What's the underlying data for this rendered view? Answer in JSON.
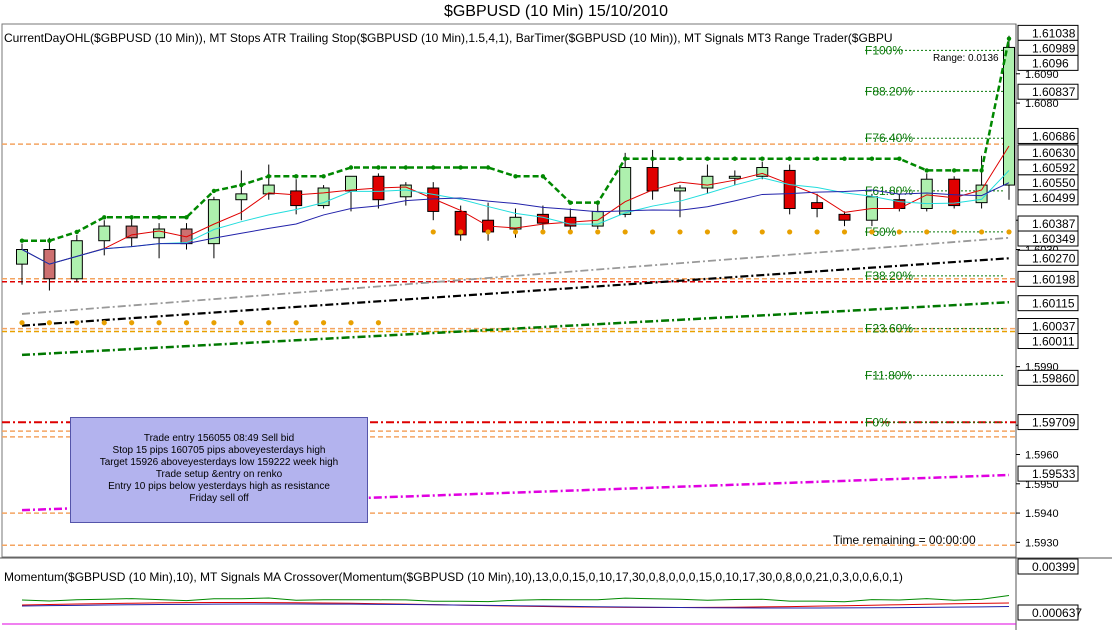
{
  "chart_data": {
    "type": "candlestick",
    "title": "$GBPUSD (10 Min)  15/10/2010",
    "main_panel": {
      "indicator_label": "CurrentDayOHL($GBPUSD (10 Min)), MT Stops ATR Trailing Stop($GBPUSD (10 Min),1.5,4,1), BarTimer($GBPUSD (10 Min)), MT Signals MT3 Range Trader($GBPU",
      "y_axis": {
        "min": 1.5925,
        "max": 1.6107,
        "ticks": [
          "1.5930",
          "1.5940",
          "1.5950",
          "1.5960",
          "1.5970",
          "1.5990",
          "1.6030",
          "1.6040",
          "1.6080",
          "1.6090"
        ]
      },
      "price_boxes": [
        "1.61038",
        "1.60989",
        "1.6096",
        "1.60837",
        "1.60686",
        "1.60630",
        "1.60592",
        "1.60550",
        "1.60499",
        "1.60387",
        "1.60349",
        "1.60270",
        "1.60198",
        "1.60115",
        "1.60037",
        "1.60011",
        "1.59860",
        "1.59709",
        "1.59533"
      ],
      "candles": [
        {
          "o": 1.6025,
          "h": 1.6032,
          "l": 1.6018,
          "c": 1.603,
          "dir": "up"
        },
        {
          "o": 1.603,
          "h": 1.6034,
          "l": 1.6016,
          "c": 1.602,
          "dir": "down"
        },
        {
          "o": 1.602,
          "h": 1.6035,
          "l": 1.6019,
          "c": 1.6033,
          "dir": "up"
        },
        {
          "o": 1.6033,
          "h": 1.604,
          "l": 1.6028,
          "c": 1.6038,
          "dir": "up"
        },
        {
          "o": 1.6038,
          "h": 1.6041,
          "l": 1.6031,
          "c": 1.6034,
          "dir": "down"
        },
        {
          "o": 1.6034,
          "h": 1.6039,
          "l": 1.6027,
          "c": 1.6037,
          "dir": "up"
        },
        {
          "o": 1.6037,
          "h": 1.6039,
          "l": 1.603,
          "c": 1.6032,
          "dir": "down"
        },
        {
          "o": 1.6032,
          "h": 1.6048,
          "l": 1.6027,
          "c": 1.6047,
          "dir": "up"
        },
        {
          "o": 1.6047,
          "h": 1.6057,
          "l": 1.604,
          "c": 1.6049,
          "dir": "up"
        },
        {
          "o": 1.6049,
          "h": 1.6059,
          "l": 1.6047,
          "c": 1.6052,
          "dir": "up"
        },
        {
          "o": 1.605,
          "h": 1.6054,
          "l": 1.6042,
          "c": 1.6045,
          "dir": "down"
        },
        {
          "o": 1.6045,
          "h": 1.6052,
          "l": 1.6044,
          "c": 1.6051,
          "dir": "up"
        },
        {
          "o": 1.605,
          "h": 1.6055,
          "l": 1.6043,
          "c": 1.6055,
          "dir": "up"
        },
        {
          "o": 1.6055,
          "h": 1.6056,
          "l": 1.6044,
          "c": 1.6047,
          "dir": "down"
        },
        {
          "o": 1.6048,
          "h": 1.6053,
          "l": 1.6045,
          "c": 1.6052,
          "dir": "up"
        },
        {
          "o": 1.6051,
          "h": 1.6053,
          "l": 1.604,
          "c": 1.6043,
          "dir": "down"
        },
        {
          "o": 1.6043,
          "h": 1.6045,
          "l": 1.6033,
          "c": 1.6035,
          "dir": "down"
        },
        {
          "o": 1.604,
          "h": 1.6046,
          "l": 1.6033,
          "c": 1.6036,
          "dir": "down"
        },
        {
          "o": 1.6037,
          "h": 1.6044,
          "l": 1.6034,
          "c": 1.6041,
          "dir": "up"
        },
        {
          "o": 1.6042,
          "h": 1.6045,
          "l": 1.6036,
          "c": 1.6039,
          "dir": "down"
        },
        {
          "o": 1.6041,
          "h": 1.6044,
          "l": 1.6036,
          "c": 1.6038,
          "dir": "down"
        },
        {
          "o": 1.6038,
          "h": 1.6046,
          "l": 1.6037,
          "c": 1.6043,
          "dir": "up"
        },
        {
          "o": 1.6042,
          "h": 1.6063,
          "l": 1.6041,
          "c": 1.6058,
          "dir": "up"
        },
        {
          "o": 1.6058,
          "h": 1.6064,
          "l": 1.6047,
          "c": 1.605,
          "dir": "down"
        },
        {
          "o": 1.605,
          "h": 1.6052,
          "l": 1.6041,
          "c": 1.6051,
          "dir": "up"
        },
        {
          "o": 1.6051,
          "h": 1.6059,
          "l": 1.6049,
          "c": 1.6055,
          "dir": "up"
        },
        {
          "o": 1.6055,
          "h": 1.6057,
          "l": 1.6052,
          "c": 1.6055,
          "dir": "up"
        },
        {
          "o": 1.6055,
          "h": 1.606,
          "l": 1.6054,
          "c": 1.6058,
          "dir": "up"
        },
        {
          "o": 1.6057,
          "h": 1.6059,
          "l": 1.6042,
          "c": 1.6044,
          "dir": "down"
        },
        {
          "o": 1.6046,
          "h": 1.6049,
          "l": 1.6041,
          "c": 1.6044,
          "dir": "down"
        },
        {
          "o": 1.6042,
          "h": 1.6043,
          "l": 1.6038,
          "c": 1.604,
          "dir": "down"
        },
        {
          "o": 1.604,
          "h": 1.6049,
          "l": 1.6038,
          "c": 1.6048,
          "dir": "up"
        },
        {
          "o": 1.6047,
          "h": 1.6049,
          "l": 1.6043,
          "c": 1.6044,
          "dir": "down"
        },
        {
          "o": 1.6044,
          "h": 1.6056,
          "l": 1.6043,
          "c": 1.6054,
          "dir": "up"
        },
        {
          "o": 1.6054,
          "h": 1.6055,
          "l": 1.6044,
          "c": 1.6045,
          "dir": "down"
        },
        {
          "o": 1.6046,
          "h": 1.6062,
          "l": 1.6044,
          "c": 1.6052,
          "dir": "up"
        },
        {
          "o": 1.6052,
          "h": 1.6103,
          "l": 1.6047,
          "c": 1.6099,
          "dir": "up"
        }
      ],
      "fib_levels": [
        {
          "label": "F100%",
          "value": 1.6098
        },
        {
          "label": "F88.20%",
          "value": 1.6084
        },
        {
          "label": "F76.40%",
          "value": 1.6068
        },
        {
          "label": "F61.80%",
          "value": 1.605
        },
        {
          "label": "F50%",
          "value": 1.6036
        },
        {
          "label": "F38.20%",
          "value": 1.6021
        },
        {
          "label": "F23.60%",
          "value": 1.6003
        },
        {
          "label": "F11.80%",
          "value": 1.5987
        },
        {
          "label": "F0%",
          "value": 1.5971
        }
      ],
      "range_label": "Range: 0.0136",
      "horizontal_lines": [
        {
          "value": 1.6066,
          "color": "#f4a460",
          "style": "dashed"
        },
        {
          "value": 1.6019,
          "color": "#dd0000",
          "style": "dashed"
        },
        {
          "value": 1.602,
          "color": "#f4a460",
          "style": "dashed"
        },
        {
          "value": 1.6002,
          "color": "#e8a000",
          "style": "dashed"
        },
        {
          "value": 1.6003,
          "color": "#f4a460",
          "style": "dashed"
        },
        {
          "value": 1.5971,
          "color": "#dd0000",
          "style": "dashdot"
        },
        {
          "value": 1.5968,
          "color": "#f4a460",
          "style": "dashed"
        },
        {
          "value": 1.5966,
          "color": "#f4a460",
          "style": "dashed"
        },
        {
          "value": 1.594,
          "color": "#f4a460",
          "style": "dashed"
        },
        {
          "value": 1.5929,
          "color": "#f4a460",
          "style": "dashed"
        }
      ],
      "note_lines": [
        "Trade entry 156055 08:49 Sell bid",
        "Stop 15 pips 160705 pips aboveyesterdays high",
        "Target 15926 aboveyesterdays low 159222 week high",
        "Trade setup &entry on renko",
        "Entry 10 pips below yesterdays high as resistance",
        "Friday sell off"
      ],
      "time_remaining": "Time remaining = 00:00:00"
    },
    "lower_panel": {
      "indicator_label": "Momentum($GBPUSD (10 Min),10), MT Signals MA Crossover(Momentum($GBPUSD (10 Min),10),13,0,0,15,0,10,17,30,0,8,0,0,0,15,0,10,17,30,0,8,0,0,21,0,3,0,0,6,0,1)",
      "price_boxes": [
        "0.00399",
        "0.000637"
      ]
    },
    "colors": {
      "up_candle": "#aef0ae",
      "down_candle": "#e00000",
      "down_candle_alt": "#cd7070",
      "trailing_stop": "#008800",
      "fib": "#0a7a0a",
      "magenta": "#e000e0",
      "orange": "#e8a000"
    }
  }
}
